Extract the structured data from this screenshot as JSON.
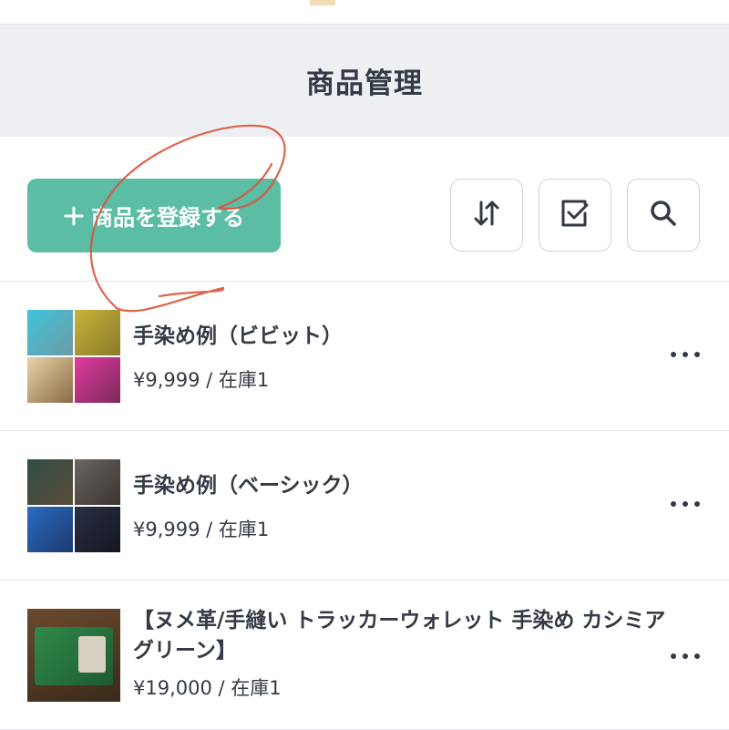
{
  "header": {
    "title": "商品管理"
  },
  "toolbar": {
    "add_label": "商品を登録する",
    "icons": {
      "add": "plus-icon",
      "sort": "sort-arrows-icon",
      "select": "checkbox-icon",
      "search": "search-icon"
    }
  },
  "colors": {
    "accent": "#5bbda4",
    "header_bg": "#eeeff3",
    "text": "#333a45",
    "annotation": "#d9533a"
  },
  "products": [
    {
      "name": "手染め例（ビビット）",
      "price": "¥9,999",
      "stock": "在庫1"
    },
    {
      "name": "手染め例（ベーシック）",
      "price": "¥9,999",
      "stock": "在庫1"
    },
    {
      "name": "【ヌメ革/手縫い トラッカーウォレット 手染め カシミアグリーン】",
      "price": "¥19,000",
      "stock": "在庫1"
    }
  ]
}
